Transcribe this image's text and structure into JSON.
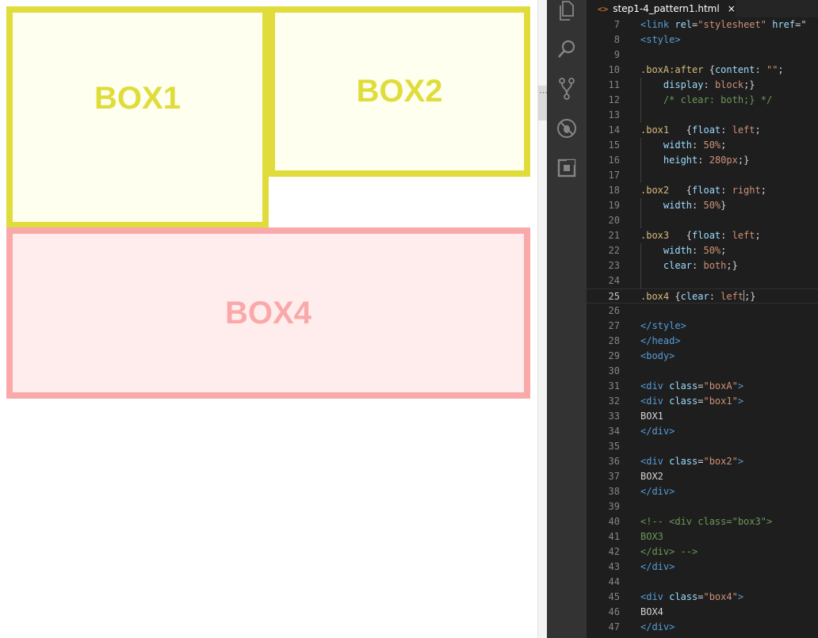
{
  "preview": {
    "box1_label": "BOX1",
    "box2_label": "BOX2",
    "box4_label": "BOX4"
  },
  "editor": {
    "tab_title": "step1-4_pattern1.html",
    "tab_icon": "<>",
    "close_glyph": "×",
    "active_line": 25,
    "lines": [
      {
        "n": 7,
        "parts": [
          [
            "<link ",
            "tag"
          ],
          [
            "rel",
            "attr"
          ],
          [
            "=",
            "txt"
          ],
          [
            "\"stylesheet\"",
            "str"
          ],
          [
            " ",
            "txt"
          ],
          [
            "href",
            "attr"
          ],
          [
            "=\"",
            "txt"
          ]
        ]
      },
      {
        "n": 8,
        "parts": [
          [
            "<style>",
            "tag"
          ]
        ]
      },
      {
        "n": 9,
        "parts": []
      },
      {
        "n": 10,
        "parts": [
          [
            ".boxA:after",
            "sel"
          ],
          [
            " {",
            "txt"
          ],
          [
            "content",
            "attr"
          ],
          [
            ": ",
            "txt"
          ],
          [
            "\"\"",
            "str"
          ],
          [
            ";",
            "txt"
          ]
        ]
      },
      {
        "n": 11,
        "guide": true,
        "parts": [
          [
            "    ",
            "txt"
          ],
          [
            "display",
            "attr"
          ],
          [
            ": ",
            "txt"
          ],
          [
            "block",
            "str"
          ],
          [
            ";}",
            "txt"
          ]
        ]
      },
      {
        "n": 12,
        "guide": true,
        "parts": [
          [
            "    ",
            "txt"
          ],
          [
            "/* clear: both;} */",
            "cmt"
          ]
        ]
      },
      {
        "n": 13,
        "guide": true,
        "parts": []
      },
      {
        "n": 14,
        "parts": [
          [
            ".box1",
            "sel"
          ],
          [
            "   {",
            "txt"
          ],
          [
            "float",
            "attr"
          ],
          [
            ": ",
            "txt"
          ],
          [
            "left",
            "str"
          ],
          [
            ";",
            "txt"
          ]
        ]
      },
      {
        "n": 15,
        "guide": true,
        "parts": [
          [
            "    ",
            "txt"
          ],
          [
            "width",
            "attr"
          ],
          [
            ": ",
            "txt"
          ],
          [
            "50%",
            "str"
          ],
          [
            ";",
            "txt"
          ]
        ]
      },
      {
        "n": 16,
        "guide": true,
        "parts": [
          [
            "    ",
            "txt"
          ],
          [
            "height",
            "attr"
          ],
          [
            ": ",
            "txt"
          ],
          [
            "280px",
            "str"
          ],
          [
            ";}",
            "txt"
          ]
        ]
      },
      {
        "n": 17,
        "guide": true,
        "parts": []
      },
      {
        "n": 18,
        "parts": [
          [
            ".box2",
            "sel"
          ],
          [
            "   {",
            "txt"
          ],
          [
            "float",
            "attr"
          ],
          [
            ": ",
            "txt"
          ],
          [
            "right",
            "str"
          ],
          [
            ";",
            "txt"
          ]
        ]
      },
      {
        "n": 19,
        "guide": true,
        "parts": [
          [
            "    ",
            "txt"
          ],
          [
            "width",
            "attr"
          ],
          [
            ": ",
            "txt"
          ],
          [
            "50%",
            "str"
          ],
          [
            "}",
            "txt"
          ]
        ]
      },
      {
        "n": 20,
        "guide": true,
        "parts": []
      },
      {
        "n": 21,
        "parts": [
          [
            ".box3",
            "sel"
          ],
          [
            "   {",
            "txt"
          ],
          [
            "float",
            "attr"
          ],
          [
            ": ",
            "txt"
          ],
          [
            "left",
            "str"
          ],
          [
            ";",
            "txt"
          ]
        ]
      },
      {
        "n": 22,
        "guide": true,
        "parts": [
          [
            "    ",
            "txt"
          ],
          [
            "width",
            "attr"
          ],
          [
            ": ",
            "txt"
          ],
          [
            "50%",
            "str"
          ],
          [
            ";",
            "txt"
          ]
        ]
      },
      {
        "n": 23,
        "guide": true,
        "parts": [
          [
            "    ",
            "txt"
          ],
          [
            "clear",
            "attr"
          ],
          [
            ": ",
            "txt"
          ],
          [
            "both",
            "str"
          ],
          [
            ";}",
            "txt"
          ]
        ]
      },
      {
        "n": 24,
        "guide": true,
        "parts": []
      },
      {
        "n": 25,
        "parts": [
          [
            ".box4",
            "sel"
          ],
          [
            " {",
            "txt"
          ],
          [
            "clear",
            "attr"
          ],
          [
            ": ",
            "txt"
          ],
          [
            "left",
            "str"
          ],
          [
            "|caret|",
            "caret"
          ],
          [
            ";}",
            "txt"
          ]
        ]
      },
      {
        "n": 26,
        "parts": []
      },
      {
        "n": 27,
        "parts": [
          [
            "</style>",
            "tag"
          ]
        ]
      },
      {
        "n": 28,
        "parts": [
          [
            "</head>",
            "tag"
          ]
        ]
      },
      {
        "n": 29,
        "parts": [
          [
            "<body>",
            "tag"
          ]
        ]
      },
      {
        "n": 30,
        "parts": []
      },
      {
        "n": 31,
        "parts": [
          [
            "<div ",
            "tag"
          ],
          [
            "class",
            "attr"
          ],
          [
            "=",
            "txt"
          ],
          [
            "\"boxA\"",
            "str"
          ],
          [
            ">",
            "tag"
          ]
        ]
      },
      {
        "n": 32,
        "parts": [
          [
            "<div ",
            "tag"
          ],
          [
            "class",
            "attr"
          ],
          [
            "=",
            "txt"
          ],
          [
            "\"box1\"",
            "str"
          ],
          [
            ">",
            "tag"
          ]
        ]
      },
      {
        "n": 33,
        "parts": [
          [
            "BOX1",
            "txt"
          ]
        ]
      },
      {
        "n": 34,
        "parts": [
          [
            "</div>",
            "tag"
          ]
        ]
      },
      {
        "n": 35,
        "parts": []
      },
      {
        "n": 36,
        "parts": [
          [
            "<div ",
            "tag"
          ],
          [
            "class",
            "attr"
          ],
          [
            "=",
            "txt"
          ],
          [
            "\"box2\"",
            "str"
          ],
          [
            ">",
            "tag"
          ]
        ]
      },
      {
        "n": 37,
        "parts": [
          [
            "BOX2",
            "txt"
          ]
        ]
      },
      {
        "n": 38,
        "parts": [
          [
            "</div>",
            "tag"
          ]
        ]
      },
      {
        "n": 39,
        "parts": []
      },
      {
        "n": 40,
        "parts": [
          [
            "<!-- <div class=\"box3\">",
            "cmt"
          ]
        ]
      },
      {
        "n": 41,
        "parts": [
          [
            "BOX3",
            "cmt"
          ]
        ]
      },
      {
        "n": 42,
        "parts": [
          [
            "</div> -->",
            "cmt"
          ]
        ]
      },
      {
        "n": 43,
        "parts": [
          [
            "</div>",
            "tag"
          ]
        ]
      },
      {
        "n": 44,
        "parts": []
      },
      {
        "n": 45,
        "parts": [
          [
            "<div ",
            "tag"
          ],
          [
            "class",
            "attr"
          ],
          [
            "=",
            "txt"
          ],
          [
            "\"box4\"",
            "str"
          ],
          [
            ">",
            "tag"
          ]
        ]
      },
      {
        "n": 46,
        "parts": [
          [
            "BOX4",
            "txt"
          ]
        ]
      },
      {
        "n": 47,
        "parts": [
          [
            "</div>",
            "tag"
          ]
        ]
      }
    ]
  },
  "activity_bar": {
    "icons": [
      "explorer-icon",
      "search-icon",
      "source-control-icon",
      "debug-icon",
      "extensions-icon"
    ]
  },
  "colors": {
    "yellow_border": "#e0dc3c",
    "yellow_fill": "#fffff0",
    "pink_border": "#f9a9a9",
    "pink_fill": "#ffecec",
    "editor_bg": "#1e1e1e",
    "activity_bg": "#333333"
  }
}
